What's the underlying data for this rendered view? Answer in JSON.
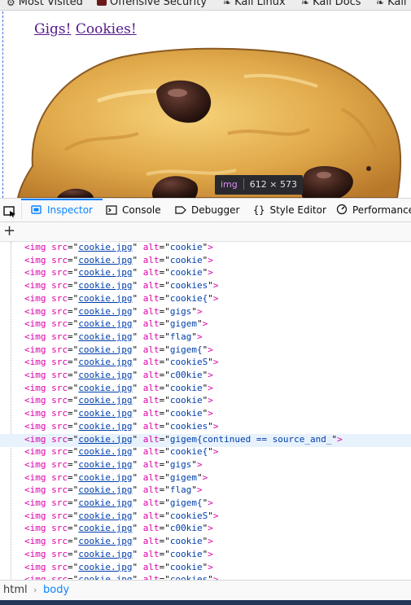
{
  "bookmarks": [
    {
      "label": "Most Visited"
    },
    {
      "label": "Offensive Security"
    },
    {
      "label": "Kali Linux"
    },
    {
      "label": "Kali Docs"
    },
    {
      "label": "Kali"
    }
  ],
  "page": {
    "link1": "Gigs!",
    "link2": "Cookies!"
  },
  "tooltip": {
    "tag": "img",
    "size": "612 × 573"
  },
  "devtools": {
    "tabs": [
      {
        "label": "Inspector",
        "icon": "inspector-icon",
        "active": true
      },
      {
        "label": "Console",
        "icon": "console-icon"
      },
      {
        "label": "Debugger",
        "icon": "debugger-icon"
      },
      {
        "label": "Style Editor",
        "icon": "style-editor-icon"
      },
      {
        "label": "Performance",
        "icon": "performance-icon"
      }
    ],
    "accent": "#0a84ff"
  },
  "markup": {
    "tag": "img",
    "src_attr": "src",
    "src_value": "cookie.jpg",
    "alt_attr": "alt",
    "lines": [
      "cookie",
      "cookie",
      "cookie",
      "cookies",
      "cookie{",
      "gigs",
      "gigem",
      "flag",
      "gigem{",
      "cookieS",
      "c00kie",
      "cookie",
      "cookie",
      "cookie",
      "cookies",
      "gigem{continued == source_and_",
      "cookie{",
      "gigs",
      "gigem",
      "flag",
      "gigem{",
      "cookieS",
      "c00kie",
      "cookie",
      "cookie",
      "cookie",
      "cookies"
    ],
    "selected_index": 15
  },
  "breadcrumbs": {
    "root": "html",
    "current": "body"
  }
}
